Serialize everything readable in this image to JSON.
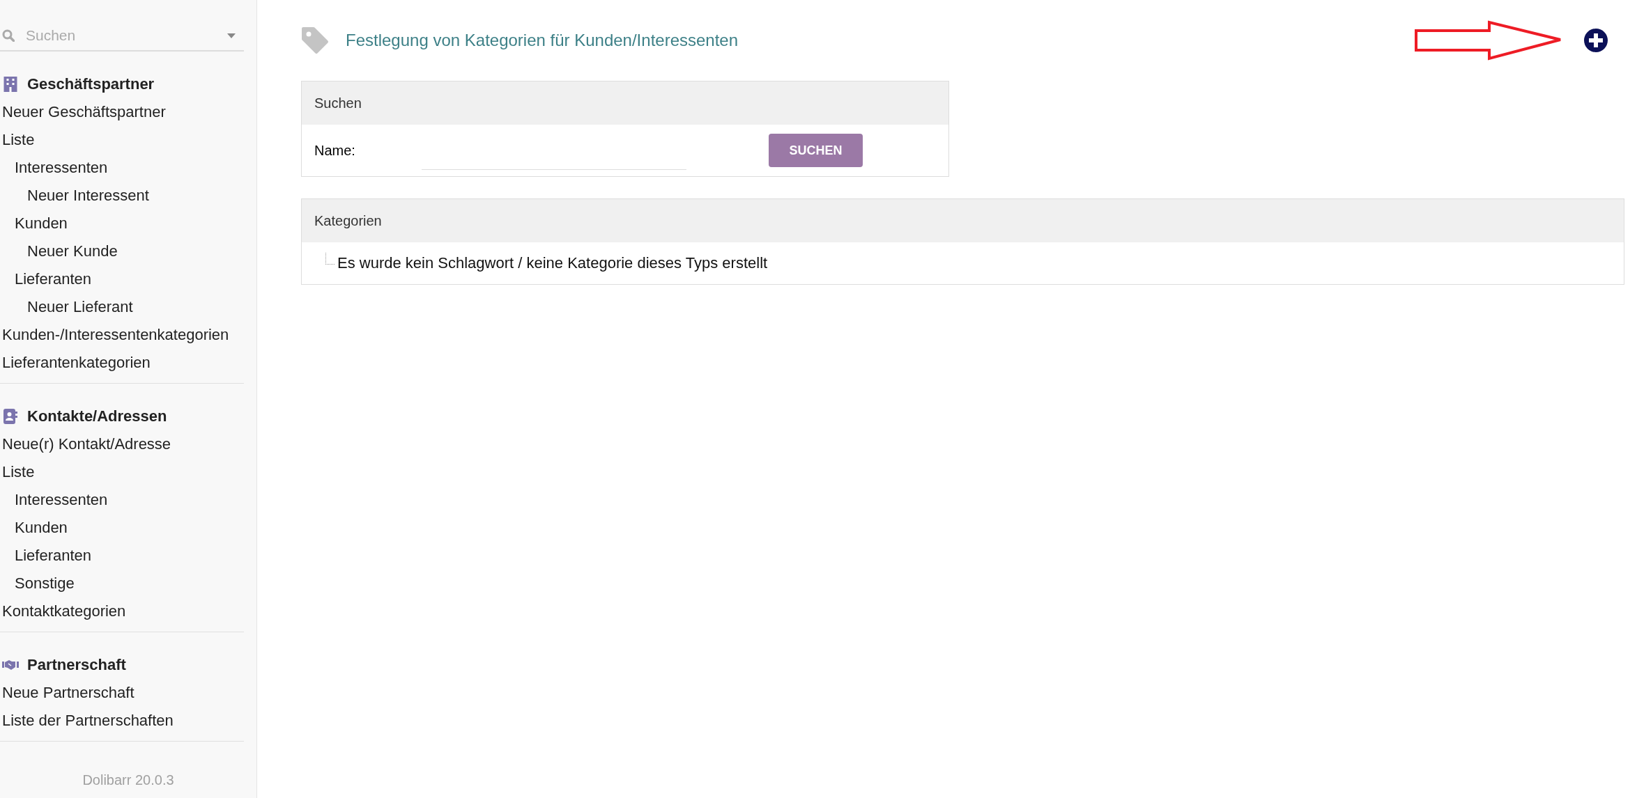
{
  "sidebar": {
    "search": {
      "placeholder": "Suchen"
    },
    "sections": [
      {
        "kind": "building",
        "title": "Geschäftspartner",
        "items": [
          {
            "label": "Neuer Geschäftspartner"
          },
          {
            "label": "Liste",
            "children": [
              {
                "label": "Interessenten",
                "children": [
                  {
                    "label": "Neuer Interessent"
                  }
                ]
              },
              {
                "label": "Kunden",
                "children": [
                  {
                    "label": "Neuer Kunde"
                  }
                ]
              },
              {
                "label": "Lieferanten",
                "children": [
                  {
                    "label": "Neuer Lieferant"
                  }
                ]
              }
            ]
          },
          {
            "label": "Kunden-/Interessentenkategorien"
          },
          {
            "label": "Lieferantenkategorien"
          }
        ]
      },
      {
        "kind": "contact",
        "title": "Kontakte/Adressen",
        "items": [
          {
            "label": "Neue(r) Kontakt/Adresse"
          },
          {
            "label": "Liste",
            "children": [
              {
                "label": "Interessenten"
              },
              {
                "label": "Kunden"
              },
              {
                "label": "Lieferanten"
              },
              {
                "label": "Sonstige"
              }
            ]
          },
          {
            "label": "Kontaktkategorien"
          }
        ]
      },
      {
        "kind": "handshake",
        "title": "Partnerschaft",
        "items": [
          {
            "label": "Neue Partnerschaft"
          },
          {
            "label": "Liste der Partnerschaften"
          }
        ]
      }
    ],
    "version": "Dolibarr 20.0.3"
  },
  "page": {
    "title": "Festlegung von Kategorien für Kunden/Interessenten",
    "search_panel": {
      "title": "Suchen",
      "field_label": "Name:",
      "button": "SUCHEN"
    },
    "categories_panel": {
      "title": "Kategorien",
      "empty_message": "Es wurde kein Schlagwort / keine Kategorie dieses Typs erstellt"
    }
  }
}
